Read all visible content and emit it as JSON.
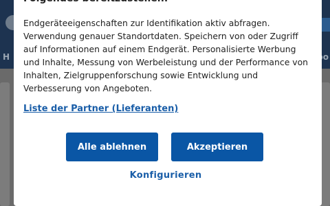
{
  "background": {
    "nav_left_letter": "H",
    "nav_right_text": "po"
  },
  "dialog": {
    "heading": "Folgendes bereitzustellen:",
    "body": "Endgeräteeigenschaften zur Identifikation aktiv abfragen. Verwendung genauer Standortdaten. Speichern von oder Zugriff auf Informationen auf einem Endgerät. Personalisierte Werbung und Inhalte, Messung von Werbeleistung und der Performance von Inhalten, Zielgruppenforschung sowie Entwicklung und Verbesserung von Angeboten.",
    "partner_link": "Liste der Partner (Lieferanten)",
    "reject_label": "Alle ablehnen",
    "accept_label": "Akzeptieren",
    "configure_label": "Konfigurieren"
  },
  "colors": {
    "primary_button": "#0a56a5",
    "link": "#1a5ea8",
    "overlay": "#3b3b3b"
  }
}
